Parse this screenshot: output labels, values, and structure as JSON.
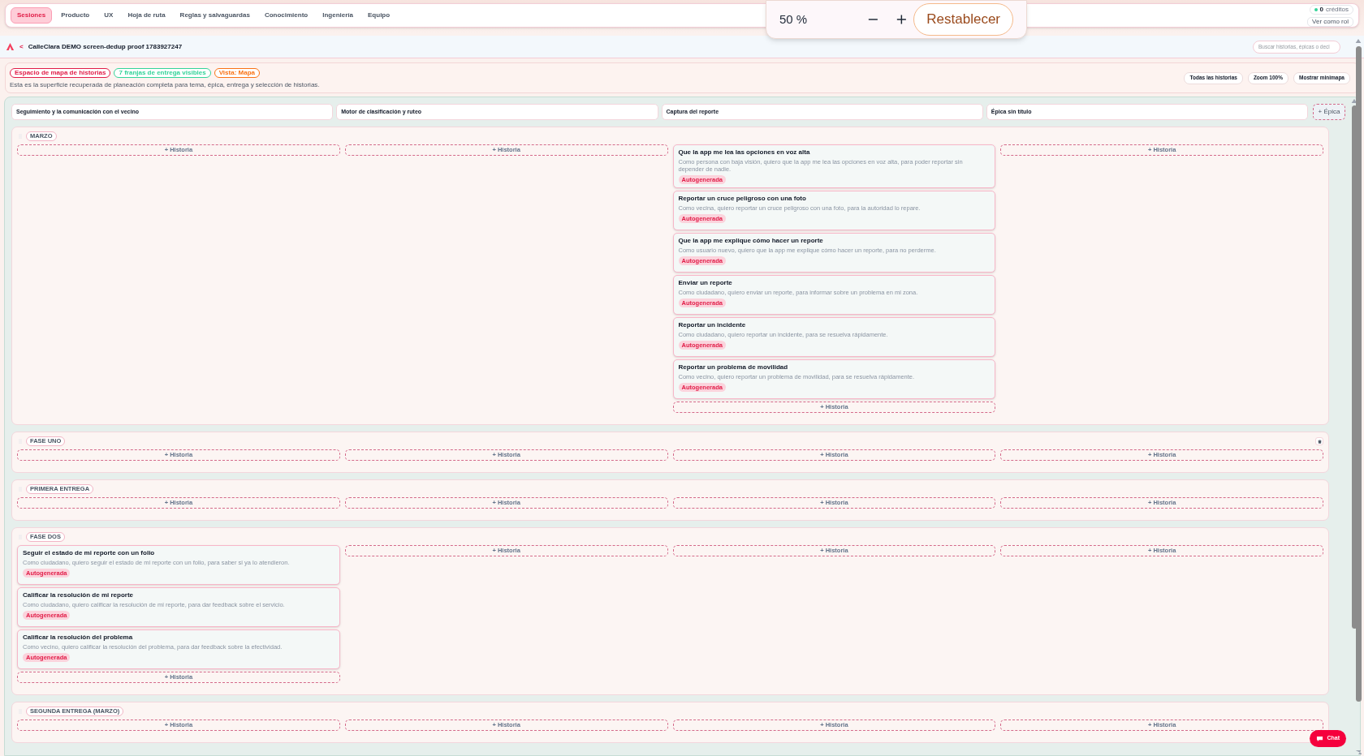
{
  "nav": {
    "tabs": [
      {
        "label": "Sesiones",
        "selected": true
      },
      {
        "label": "Producto",
        "selected": false
      },
      {
        "label": "UX",
        "selected": false
      },
      {
        "label": "Hoja de ruta",
        "selected": false
      },
      {
        "label": "Reglas y salvaguardas",
        "selected": false
      },
      {
        "label": "Conocimiento",
        "selected": false
      },
      {
        "label": "Ingeniería",
        "selected": false
      },
      {
        "label": "Equipo",
        "selected": false
      }
    ],
    "credits": {
      "count": "0",
      "label": "créditos"
    },
    "role_button": "Ver como rol"
  },
  "zoom_popover": {
    "value": "50 %",
    "reset": "Restablecer"
  },
  "header": {
    "back": "<",
    "title": "CalleClara DEMO screen-dedup proof 1783927247",
    "search_placeholder": "Buscar historias, épicas o deci"
  },
  "info": {
    "badges": [
      {
        "label": "Espacio de mapa de historias",
        "color": "#e11d48"
      },
      {
        "label": "7 franjas de entrega visibles",
        "color": "#34d399"
      },
      {
        "label": "Vista: Mapa",
        "color": "#f97316"
      }
    ],
    "description": "Esta es la superficie recuperada de planeación completa para tema, épica, entrega y selección de historias.",
    "buttons": [
      "Todas las historias",
      "Zoom 100%",
      "Mostrar minimapa"
    ]
  },
  "epics": [
    "Seguimiento y la comunicación con el vecino",
    "Motor de clasificación y ruteo",
    "Captura del reporte",
    "Épica sin título"
  ],
  "add_epic": "+ Épica",
  "lanes": [
    {
      "label": "MARZO",
      "deletable": false,
      "cells": [
        {
          "add": "+ Historia"
        },
        {
          "add": "+ Historia"
        },
        {
          "add": "+ Historia",
          "stories": [
            {
              "title": "Que la app me lea las opciones en voz alta",
              "description": "Como persona con baja visión, quiero que la app me lea las opciones en voz alta, para poder reportar sin depender de nadie.",
              "tag": "Autogenerada"
            },
            {
              "title": "Reportar un cruce peligroso con una foto",
              "description": "Como vecina, quiero reportar un cruce peligroso con una foto, para la autoridad lo repare.",
              "tag": "Autogenerada"
            },
            {
              "title": "Que la app me explique cómo hacer un reporte",
              "description": "Como usuario nuevo, quiero que la app me explique cómo hacer un reporte, para no perderme.",
              "tag": "Autogenerada"
            },
            {
              "title": "Enviar un reporte",
              "description": "Como ciudadano, quiero enviar un reporte, para informar sobre un problema en mi zona.",
              "tag": "Autogenerada"
            },
            {
              "title": "Reportar un incidente",
              "description": "Como ciudadano, quiero reportar un incidente, para se resuelva rápidamente.",
              "tag": "Autogenerada"
            },
            {
              "title": "Reportar un problema de movilidad",
              "description": "Como vecino, quiero reportar un problema de movilidad, para se resuelva rápidamente.",
              "tag": "Autogenerada"
            }
          ]
        },
        {
          "add": "+ Historia"
        }
      ]
    },
    {
      "label": "FASE UNO",
      "deletable": true,
      "cells": [
        {
          "add": "+ Historia"
        },
        {
          "add": "+ Historia"
        },
        {
          "add": "+ Historia"
        },
        {
          "add": "+ Historia"
        }
      ]
    },
    {
      "label": "PRIMERA ENTREGA",
      "deletable": false,
      "cells": [
        {
          "add": "+ Historia"
        },
        {
          "add": "+ Historia"
        },
        {
          "add": "+ Historia"
        },
        {
          "add": "+ Historia"
        }
      ]
    },
    {
      "label": "FASE DOS",
      "deletable": false,
      "cells": [
        {
          "add": "+ Historia",
          "stories": [
            {
              "title": "Seguir el estado de mi reporte con un folio",
              "description": "Como ciudadano, quiero seguir el estado de mi reporte con un folio, para saber si ya lo atendieron.",
              "tag": "Autogenerada"
            },
            {
              "title": "Calificar la resolución de mi reporte",
              "description": "Como ciudadano, quiero calificar la resolución de mi reporte, para dar feedback sobre el servicio.",
              "tag": "Autogenerada"
            },
            {
              "title": "Calificar la resolución del problema",
              "description": "Como vecino, quiero calificar la resolución del problema, para dar feedback sobre la efectividad.",
              "tag": "Autogenerada"
            }
          ]
        },
        {
          "add": "+ Historia"
        },
        {
          "add": "+ Historia"
        },
        {
          "add": "+ Historia"
        }
      ]
    },
    {
      "label": "SEGUNDA ENTREGA (MARZO)",
      "deletable": false,
      "cells": [
        {
          "add": "+ Historia"
        },
        {
          "add": "+ Historia"
        },
        {
          "add": "+ Historia"
        },
        {
          "add": "+ Historia"
        }
      ]
    }
  ],
  "chat_button": "Chat"
}
